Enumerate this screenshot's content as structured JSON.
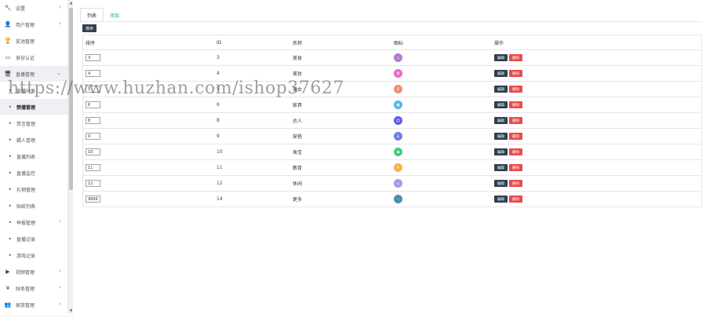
{
  "sidebar": {
    "items": [
      {
        "label": "设置",
        "icon": "wrench-icon",
        "type": "top",
        "arrow": "›"
      },
      {
        "label": "用户管理",
        "icon": "user-icon",
        "type": "top",
        "arrow": "›"
      },
      {
        "label": "奖池管理",
        "icon": "trophy-icon",
        "type": "top",
        "arrow": ""
      },
      {
        "label": "身份认证",
        "icon": "id-card-icon",
        "type": "top",
        "arrow": ""
      },
      {
        "label": "直播管理",
        "icon": "monitor-icon",
        "type": "top",
        "arrow": "⌄",
        "active": true
      },
      {
        "label": "直播分类",
        "type": "sub"
      },
      {
        "label": "禁播管理",
        "type": "sub",
        "active": true
      },
      {
        "label": "禁言管理",
        "type": "sub"
      },
      {
        "label": "踢人管理",
        "type": "sub"
      },
      {
        "label": "直播列表",
        "type": "sub"
      },
      {
        "label": "直播监控",
        "type": "sub"
      },
      {
        "label": "礼物管理",
        "type": "sub"
      },
      {
        "label": "贴纸列表",
        "type": "sub"
      },
      {
        "label": "举报管理",
        "type": "sub",
        "arrow": "›"
      },
      {
        "label": "直播记录",
        "type": "sub"
      },
      {
        "label": "游戏记录",
        "type": "sub"
      },
      {
        "label": "视频管理",
        "icon": "video-icon",
        "type": "top",
        "arrow": "›"
      },
      {
        "label": "财务管理",
        "icon": "yen-icon",
        "type": "top",
        "arrow": "›"
      },
      {
        "label": "家族管理",
        "icon": "group-icon",
        "type": "top",
        "arrow": "›"
      }
    ]
  },
  "tabs": {
    "list": "列表",
    "add": "添加"
  },
  "toolbar": {
    "sort_label": "排序"
  },
  "table": {
    "headers": {
      "sort": "排序",
      "id": "ID",
      "name": "名称",
      "icon": "图标",
      "ops": "操作"
    },
    "edit_label": "编辑",
    "delete_label": "删除",
    "rows": [
      {
        "sort": "3",
        "id": "3",
        "name": "美食",
        "color": "#b07ad6",
        "glyph": "♨"
      },
      {
        "sort": "4",
        "id": "4",
        "name": "美妆",
        "color": "#e86bc4",
        "glyph": "✿"
      },
      {
        "sort": "5",
        "id": "5",
        "name": "美女",
        "color": "#f08a7a",
        "glyph": "♀"
      },
      {
        "sort": "6",
        "id": "6",
        "name": "家具",
        "color": "#4fb3f0",
        "glyph": "▣"
      },
      {
        "sort": "8",
        "id": "8",
        "name": "达人",
        "color": "#5b5be6",
        "glyph": "☺"
      },
      {
        "sort": "9",
        "id": "9",
        "name": "穿搭",
        "color": "#6f7ee8",
        "glyph": "♙"
      },
      {
        "sort": "10",
        "id": "10",
        "name": "珠宝",
        "color": "#3fce7e",
        "glyph": "◆"
      },
      {
        "sort": "11",
        "id": "11",
        "name": "教育",
        "color": "#f2b24c",
        "glyph": "✎"
      },
      {
        "sort": "12",
        "id": "12",
        "name": "休闲",
        "color": "#a79ae8",
        "glyph": "☕"
      },
      {
        "sort": "9999",
        "id": "14",
        "name": "更多",
        "color": "#4a8fa8",
        "glyph": "⋯"
      }
    ]
  },
  "watermark": "https://www.huzhan.com/ishop37627"
}
